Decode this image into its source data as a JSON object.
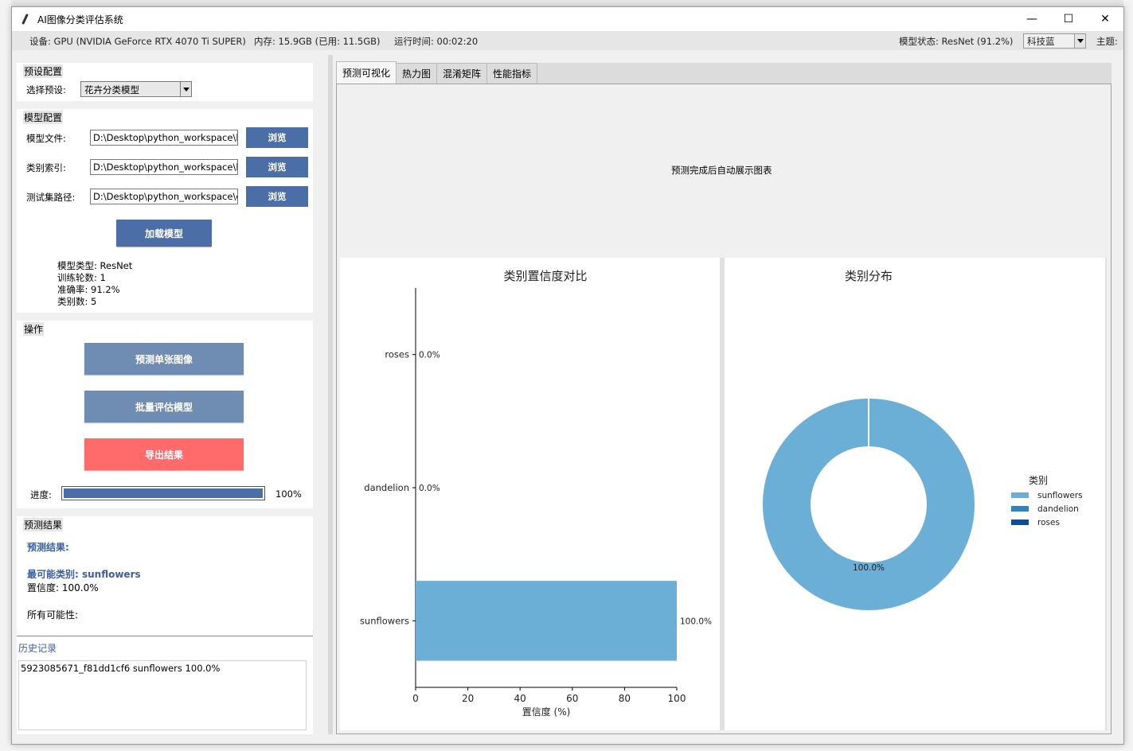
{
  "window": {
    "title": "AI图像分类评估系统",
    "minimize": "—",
    "maximize": "☐",
    "close": "✕"
  },
  "status": {
    "device": "设备: GPU (NVIDIA GeForce RTX 4070 Ti SUPER)",
    "memory": "内存: 15.9GB (已用: 11.5GB)",
    "runtime": "运行时间: 00:02:20",
    "model_status": "模型状态: ResNet (91.2%)",
    "theme_value": "科技蓝",
    "theme_label": "主题:"
  },
  "preset": {
    "title": "预设配置",
    "label": "选择预设:",
    "value": "花卉分类模型"
  },
  "model_config": {
    "title": "模型配置",
    "model_file_label": "模型文件:",
    "model_file_value": "D:\\Desktop\\python_workspace\\hu",
    "class_index_label": "类别索引:",
    "class_index_value": "D:\\Desktop\\python_workspace\\hu",
    "test_path_label": "测试集路径:",
    "test_path_value": "D:\\Desktop\\python_workspace\\de",
    "browse": "浏览",
    "load_button": "加载模型",
    "info": {
      "type": "模型类型: ResNet",
      "epochs": "训练轮数: 1",
      "accuracy": "准确率: 91.2%",
      "classes": "类别数: 5"
    }
  },
  "actions": {
    "title": "操作",
    "predict_single": "预测单张图像",
    "batch_eval": "批量评估模型",
    "export": "导出结果",
    "progress_label": "进度:",
    "progress_value": 1.0,
    "progress_text": "100%",
    "colors": {
      "primary": "#4a6ea5",
      "muted": "#6f8db3",
      "danger": "#ff6b6b"
    }
  },
  "results": {
    "title": "预测结果",
    "heading": "预测结果:",
    "top_class": "最可能类别: sunflowers",
    "confidence": "置信度: 100.0%",
    "all_label": "所有可能性:"
  },
  "history": {
    "title": "历史记录",
    "entries": [
      "5923085671_f81dd1cf6 sunflowers 100.0%"
    ]
  },
  "tabs": [
    "预测可视化",
    "热力图",
    "混淆矩阵",
    "性能指标"
  ],
  "placeholder": "预测完成后自动展示图表",
  "chart_data": [
    {
      "type": "bar",
      "orientation": "horizontal",
      "title": "类别置信度对比",
      "xlabel": "置信度 (%)",
      "categories": [
        "sunflowers",
        "dandelion",
        "roses"
      ],
      "values": [
        100.0,
        0.0,
        0.0
      ],
      "labels": [
        "100.0%",
        "0.0%",
        "0.0%"
      ],
      "xlim": [
        0,
        100
      ],
      "xticks": [
        "0",
        "20",
        "40",
        "60",
        "80",
        "100"
      ],
      "color": "#6baed6"
    },
    {
      "type": "pie",
      "donut": true,
      "title": "类别分布",
      "legend_title": "类别",
      "categories": [
        "sunflowers",
        "dandelion",
        "roses"
      ],
      "values": [
        100.0,
        0.0,
        0.0
      ],
      "slice_label": "100.0%",
      "colors": [
        "#6baed6",
        "#3182bd",
        "#08519c"
      ],
      "legend_position": "right"
    }
  ]
}
